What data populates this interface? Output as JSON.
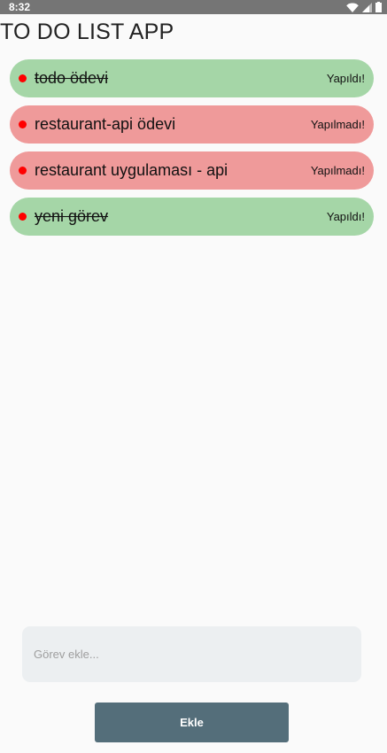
{
  "status_bar": {
    "time": "8:32",
    "icons": [
      "wifi-icon",
      "signal-icon",
      "battery-icon"
    ]
  },
  "app": {
    "title": "TO DO LIST APP"
  },
  "todos": [
    {
      "text": "todo ödevi",
      "status": "Yapıldı!",
      "done": true
    },
    {
      "text": "restaurant-api  ödevi",
      "status": "Yapılmadı!",
      "done": false
    },
    {
      "text": "restaurant uygulaması - api",
      "status": "Yapılmadı!",
      "done": false
    },
    {
      "text": "yeni görev",
      "status": "Yapıldı!",
      "done": true
    }
  ],
  "input": {
    "placeholder": "Görev ekle...",
    "value": ""
  },
  "add_button": {
    "label": "Ekle"
  },
  "colors": {
    "done_bg": "#a5d6a7",
    "undone_bg": "#ef9a9a",
    "dot": "#ff0000",
    "button_bg": "#546e7a",
    "status_bar_bg": "#757575"
  }
}
